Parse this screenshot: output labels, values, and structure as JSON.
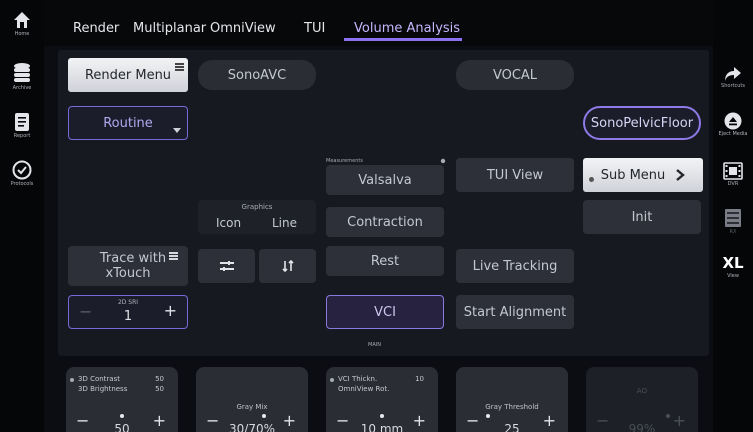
{
  "left_rail": {
    "home": "Home",
    "archive": "Archive",
    "report": "Report",
    "protocols": "Protocols"
  },
  "right_rail": {
    "shortcuts": "Shortcuts",
    "eject": "Eject Media",
    "dvr": "DVR",
    "rx": "RX",
    "xl": "XL",
    "view": "View"
  },
  "tabs": [
    {
      "label": "Render"
    },
    {
      "label": "Multiplanar"
    },
    {
      "label": "OmniView"
    },
    {
      "label": "TUI"
    },
    {
      "label": "Volume Analysis"
    }
  ],
  "main": {
    "render_menu": "Render Menu",
    "sonoavc": "SonoAVC",
    "vocal": "VOCAL",
    "routine": "Routine",
    "sonopelvicfloor": "SonoPelvicFloor",
    "measurements_tag": "Measurements",
    "valsalva": "Valsalva",
    "contraction": "Contraction",
    "rest": "Rest",
    "vci": "VCI",
    "main_tag": "MAIN",
    "tui_view": "TUI View",
    "live_tracking": "Live Tracking",
    "start_alignment": "Start Alignment",
    "sub_menu": "Sub Menu",
    "init": "Init",
    "graphics_label": "Graphics",
    "graphics_icon": "Icon",
    "graphics_line": "Line",
    "xtouch_tag": "xTouch",
    "trace_with_xtouch_1": "Trace with",
    "trace_with_xtouch_2": "xTouch",
    "sri_label": "2D SRI",
    "sri_value": "1"
  },
  "knobs": [
    {
      "line1": "3D Contrast",
      "val1": "50",
      "line2": "3D Brightness",
      "val2": "50",
      "value": "50"
    },
    {
      "label": "Gray Mix",
      "value": "30/70%"
    },
    {
      "line1": "VCI Thickn.",
      "val1": "10",
      "line2": "OmniView Rot.",
      "value": "10 mm"
    },
    {
      "label": "Gray Threshold",
      "value": "25"
    },
    {
      "label": "AO",
      "value": "99%"
    }
  ],
  "colors": {
    "accent": "#8c72f0",
    "panel": "#16191f",
    "button": "#2d3038"
  }
}
